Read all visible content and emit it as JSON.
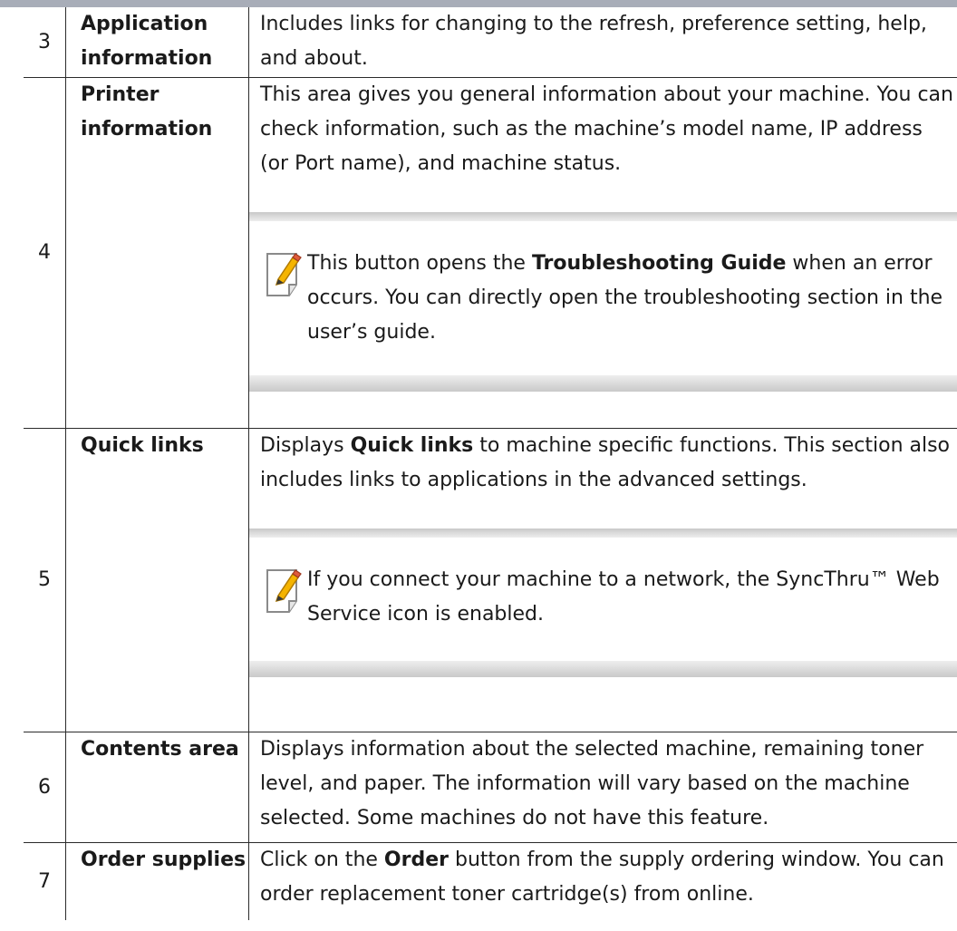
{
  "rows": [
    {
      "num": "3",
      "term": "Application information",
      "desc": "Includes links for changing to the refresh, preference setting, help, and about."
    },
    {
      "num": "4",
      "term": "Printer information",
      "desc": "This area gives you general information about your machine. You can check information, such as the machine’s model name, IP address (or Port name), and machine status.",
      "note_pre": "This button opens the ",
      "note_bold": "Troubleshooting Guide",
      "note_post": " when an error occurs. You can directly open the troubleshooting section in the user’s guide."
    },
    {
      "num": "5",
      "term": "Quick links",
      "desc_pre": "Displays ",
      "desc_bold": "Quick links",
      "desc_post": " to machine specific functions. This section also includes links to applications in the advanced settings.",
      "note": "If you connect your machine to a network, the SyncThru™ Web Service icon is enabled."
    },
    {
      "num": "6",
      "term": "Contents area",
      "desc": "Displays information about the selected machine, remaining toner level, and paper. The information will vary based on the machine selected. Some machines do not have this feature."
    },
    {
      "num": "7",
      "term": "Order supplies",
      "desc_pre": "Click on the ",
      "desc_bold": "Order",
      "desc_post": " button from the supply ordering window. You can order replacement toner cartridge(s) from online."
    }
  ],
  "icons": {
    "note": "note-pencil-icon"
  },
  "colors": {
    "top_rule": "#a8adb8",
    "note_shade": "#d6d6d6"
  }
}
